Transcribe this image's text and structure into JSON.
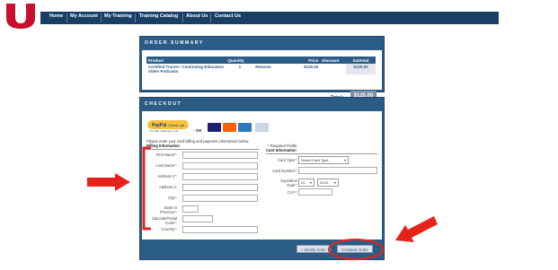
{
  "nav": {
    "items": [
      "Home",
      "My Account",
      "My Training",
      "Training Catalog",
      "About Us",
      "Contact Us"
    ]
  },
  "colors": {
    "nav_bg": "#1a3f66",
    "panel_bg": "#2b5c86",
    "annotation_red": "#e8221b",
    "logo_red": "#c8102e"
  },
  "order_summary": {
    "title": "ORDER SUMMARY",
    "columns": [
      "Product",
      "Quantity",
      "",
      "Price",
      "Discount",
      "Subtotal"
    ],
    "rows": [
      {
        "product": "Certified Trainer: Continuing Education Video Podcasts",
        "quantity": "1",
        "action": "Remove",
        "price": "$125.00",
        "discount": "",
        "subtotal": "$125.00"
      }
    ],
    "total_label": "Total:",
    "total_value": "$125.00"
  },
  "checkout": {
    "title": "CHECKOUT",
    "paypal_label": "PayPal",
    "paypal_sub": "Check out",
    "paypal_note": "The safer, easier way to pay",
    "or_label": "- OR",
    "cards": [
      "visa",
      "mastercard",
      "amex",
      "discover"
    ],
    "instruction": "Please enter your card billing and payment information below.",
    "required_note": "* Required Fields",
    "billing_title": "Billing Information",
    "card_title": "Card Information",
    "billing_fields": [
      "First Name*:",
      "Last Name*:",
      "Address 1*:",
      "Address 2:",
      "City*:",
      "State or Province*:",
      "Zipcode/Postal Code*:",
      "Country*:"
    ],
    "card_fields": {
      "card_type_label": "Card Type*:",
      "card_type_value": "Select Card Type",
      "card_number_label": "Card Number*:",
      "expiration_label": "Expiration Date*:",
      "exp_month": "01",
      "exp_year": "2016",
      "cvv_label": "CVV*:"
    },
    "modify_button": "« Modify Order",
    "complete_button": "Complete Order"
  }
}
